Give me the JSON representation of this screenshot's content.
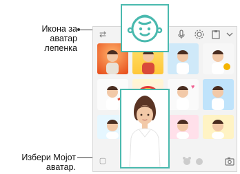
{
  "callouts": {
    "avatar_sticker_icon": "Икона за\nаватар\nлепенка",
    "select_my_avatar": "Избери Мојот\nаватар."
  },
  "colors": {
    "accent": "#49b9ae",
    "panel_bg": "#f3f3f3"
  },
  "toolbar": {
    "icons": [
      "sticker-swap-icon",
      "mic-icon",
      "settings-icon",
      "clipboard-icon",
      "chevron-down-icon"
    ]
  },
  "bottom_bar": {
    "icons": [
      "sticker-pack-icon",
      "bear-icon",
      "camera-icon"
    ]
  }
}
